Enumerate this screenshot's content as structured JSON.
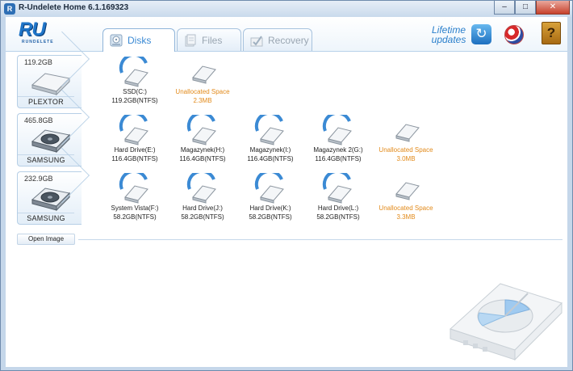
{
  "window": {
    "title": "R-Undelete Home 6.1.169323",
    "controls": {
      "minimize": "–",
      "maximize": "□",
      "close": "✕"
    }
  },
  "header": {
    "logo_text": "RU",
    "logo_sub": "RUNDELETE",
    "tabs": [
      {
        "label": "Disks",
        "icon": "disk-icon",
        "active": true
      },
      {
        "label": "Files",
        "icon": "files-icon",
        "active": false
      },
      {
        "label": "Recovery",
        "icon": "recovery-icon",
        "active": false
      }
    ],
    "lifetime_line1": "Lifetime",
    "lifetime_line2": "updates",
    "refresh_glyph": "↻",
    "help_glyph": "?"
  },
  "disks": [
    {
      "size": "119.2GB",
      "name": "PLEXTOR",
      "kind": "ssd",
      "volumes": [
        {
          "name": "SSD(C:)",
          "detail": "119.2GB(NTFS)",
          "unallocated": false
        },
        {
          "name": "Unallocated Space",
          "detail": "2.3MB",
          "unallocated": true
        }
      ]
    },
    {
      "size": "465.8GB",
      "name": "SAMSUNG",
      "kind": "hdd",
      "volumes": [
        {
          "name": "Hard Drive(E:)",
          "detail": "116.4GB(NTFS)",
          "unallocated": false
        },
        {
          "name": "Magazynek(H:)",
          "detail": "116.4GB(NTFS)",
          "unallocated": false
        },
        {
          "name": "Magazynek(I:)",
          "detail": "116.4GB(NTFS)",
          "unallocated": false
        },
        {
          "name": "Magazynek 2(G:)",
          "detail": "116.4GB(NTFS)",
          "unallocated": false
        },
        {
          "name": "Unallocated Space",
          "detail": "3.0MB",
          "unallocated": true
        }
      ]
    },
    {
      "size": "232.9GB",
      "name": "SAMSUNG",
      "kind": "hdd",
      "volumes": [
        {
          "name": "System Vista(F:)",
          "detail": "58.2GB(NTFS)",
          "unallocated": false
        },
        {
          "name": "Hard Drive(J:)",
          "detail": "58.2GB(NTFS)",
          "unallocated": false
        },
        {
          "name": "Hard Drive(K:)",
          "detail": "58.2GB(NTFS)",
          "unallocated": false
        },
        {
          "name": "Hard Drive(L:)",
          "detail": "58.2GB(NTFS)",
          "unallocated": false
        },
        {
          "name": "Unallocated Space",
          "detail": "3.3MB",
          "unallocated": true
        }
      ]
    }
  ],
  "open_image_label": "Open Image",
  "colors": {
    "accent": "#3b8ad4",
    "unallocated": "#e28a1a",
    "border": "#b6cfe6"
  }
}
